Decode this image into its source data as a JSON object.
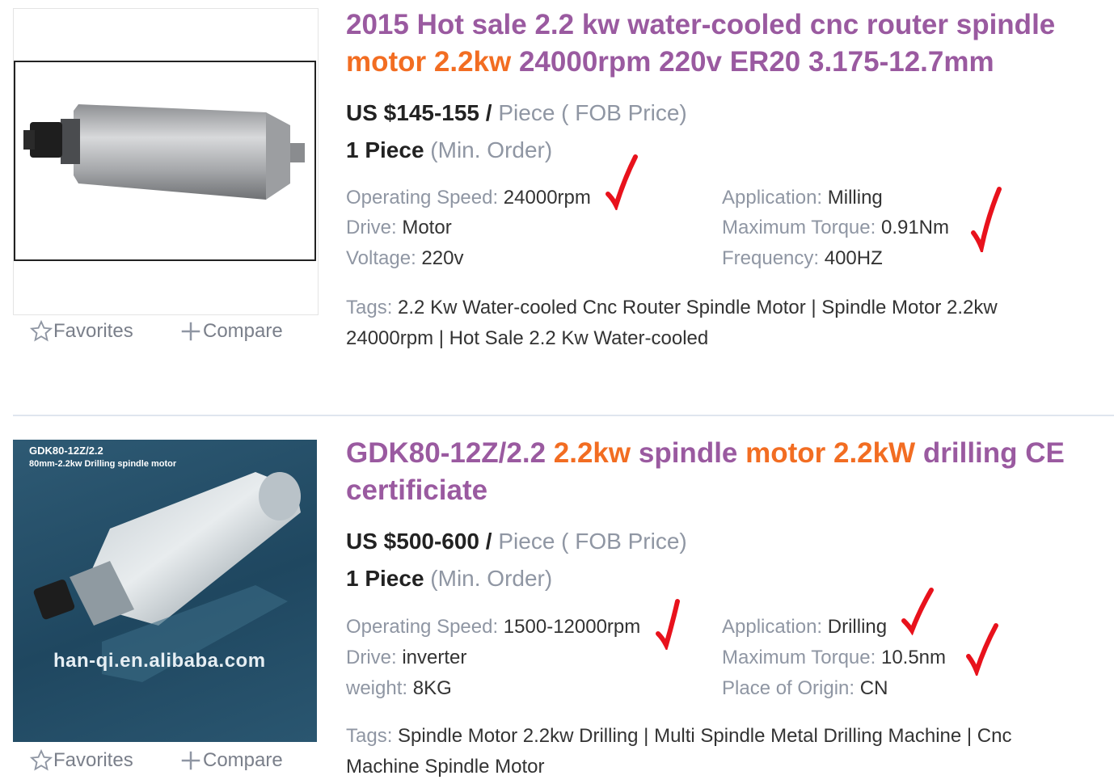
{
  "listings": [
    {
      "title_parts": [
        "2015 Hot sale 2.2 kw water-cooled cnc router spindle ",
        "motor 2.2kw",
        " 24000rpm 220v ER20 3.175-12.7mm"
      ],
      "price": "US $145-155 /",
      "price_suffix": " Piece ( FOB Price)",
      "moq": "1 Piece",
      "moq_suffix": " (Min. Order)",
      "attrs": {
        "operating_speed": {
          "label": "Operating Speed:",
          "value": " 24000rpm"
        },
        "drive": {
          "label": "Drive:",
          "value": " Motor"
        },
        "voltage": {
          "label": "Voltage:",
          "value": " 220v"
        },
        "application": {
          "label": "Application:",
          "value": " Milling"
        },
        "max_torque": {
          "label": "Maximum Torque:",
          "value": " 0.91Nm"
        },
        "frequency": {
          "label": "Frequency:",
          "value": " 400HZ"
        }
      },
      "tags_label": "Tags:",
      "tags_text": " 2.2 Kw Water-cooled Cnc Router Spindle Motor | Spindle Motor 2.2kw 24000rpm | Hot Sale 2.2 Kw Water-cooled",
      "favorites_label": "Favorites",
      "compare_label": "Compare"
    },
    {
      "title_parts": [
        "GDK80-12Z/2.2 ",
        "2.2kw",
        " spindle ",
        "motor 2.2kW",
        " drilling CE certificiate"
      ],
      "image_caption_1": "GDK80-12Z/2.2",
      "image_caption_2": "80mm-2.2kw Drilling spindle motor",
      "image_watermark": "han-qi.en.alibaba.com",
      "price": "US $500-600 /",
      "price_suffix": " Piece ( FOB Price)",
      "moq": "1 Piece",
      "moq_suffix": " (Min. Order)",
      "attrs": {
        "operating_speed": {
          "label": "Operating Speed:",
          "value": " 1500-12000rpm"
        },
        "drive": {
          "label": "Drive:",
          "value": " inverter"
        },
        "weight": {
          "label": "weight:",
          "value": " 8KG"
        },
        "application": {
          "label": "Application:",
          "value": " Drilling"
        },
        "max_torque": {
          "label": "Maximum Torque:",
          "value": " 10.5nm"
        },
        "origin": {
          "label": "Place of Origin:",
          "value": " CN"
        }
      },
      "tags_label": "Tags:",
      "tags_text": " Spindle Motor 2.2kw Drilling | Multi Spindle Metal Drilling Machine | Cnc Machine Spindle Motor",
      "favorites_label": "Favorites",
      "compare_label": "Compare"
    }
  ],
  "colors": {
    "title": "#9a5aa0",
    "highlight": "#f26d22",
    "label_gray": "#8f96a3",
    "check_red": "#e8121c"
  },
  "icons": [
    "star-outline-icon",
    "plus-icon",
    "red-checkmark-icon"
  ]
}
